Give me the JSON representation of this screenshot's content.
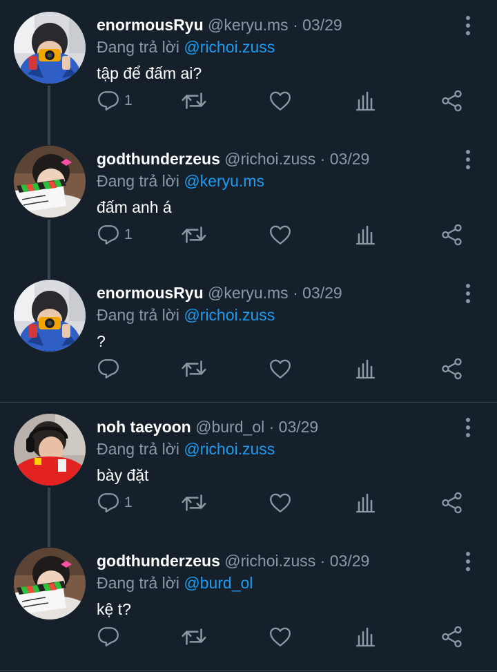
{
  "colors": {
    "background": "#15202b",
    "text": "#ffffff",
    "muted": "#8b98a5",
    "link": "#1d9bf0",
    "line": "#38444d"
  },
  "tweets": [
    {
      "name": "enormousRyu",
      "handle": "@keryu.ms",
      "separator": "·",
      "date": "03/29",
      "reply_label": "Đang trả lời",
      "reply_to": "@richoi.zuss",
      "text": "tập để đấm ai?",
      "reply_count": "1",
      "avatar": "avatar-camera"
    },
    {
      "name": "godthunderzeus",
      "handle": "@richoi.zuss",
      "separator": "·",
      "date": "03/29",
      "reply_label": "Đang trả lời",
      "reply_to": "@keryu.ms",
      "text": "đấm anh á",
      "reply_count": "1",
      "avatar": "avatar-clapper"
    },
    {
      "name": "enormousRyu",
      "handle": "@keryu.ms",
      "separator": "·",
      "date": "03/29",
      "reply_label": "Đang trả lời",
      "reply_to": "@richoi.zuss",
      "text": "?",
      "reply_count": "",
      "avatar": "avatar-camera"
    },
    {
      "name": "noh taeyoon",
      "handle": "@burd_ol",
      "separator": "·",
      "date": "03/29",
      "reply_label": "Đang trả lời",
      "reply_to": "@richoi.zuss",
      "text": "bày đặt",
      "reply_count": "1",
      "avatar": "avatar-headset"
    },
    {
      "name": "godthunderzeus",
      "handle": "@richoi.zuss",
      "separator": "·",
      "date": "03/29",
      "reply_label": "Đang trả lời",
      "reply_to": "@burd_ol",
      "text": "kệ t?",
      "reply_count": "",
      "avatar": "avatar-clapper"
    }
  ],
  "icons": {
    "reply": "reply-icon",
    "retweet": "retweet-icon",
    "like": "heart-icon",
    "views": "analytics-icon",
    "share": "share-icon",
    "more": "more-vertical-icon"
  }
}
